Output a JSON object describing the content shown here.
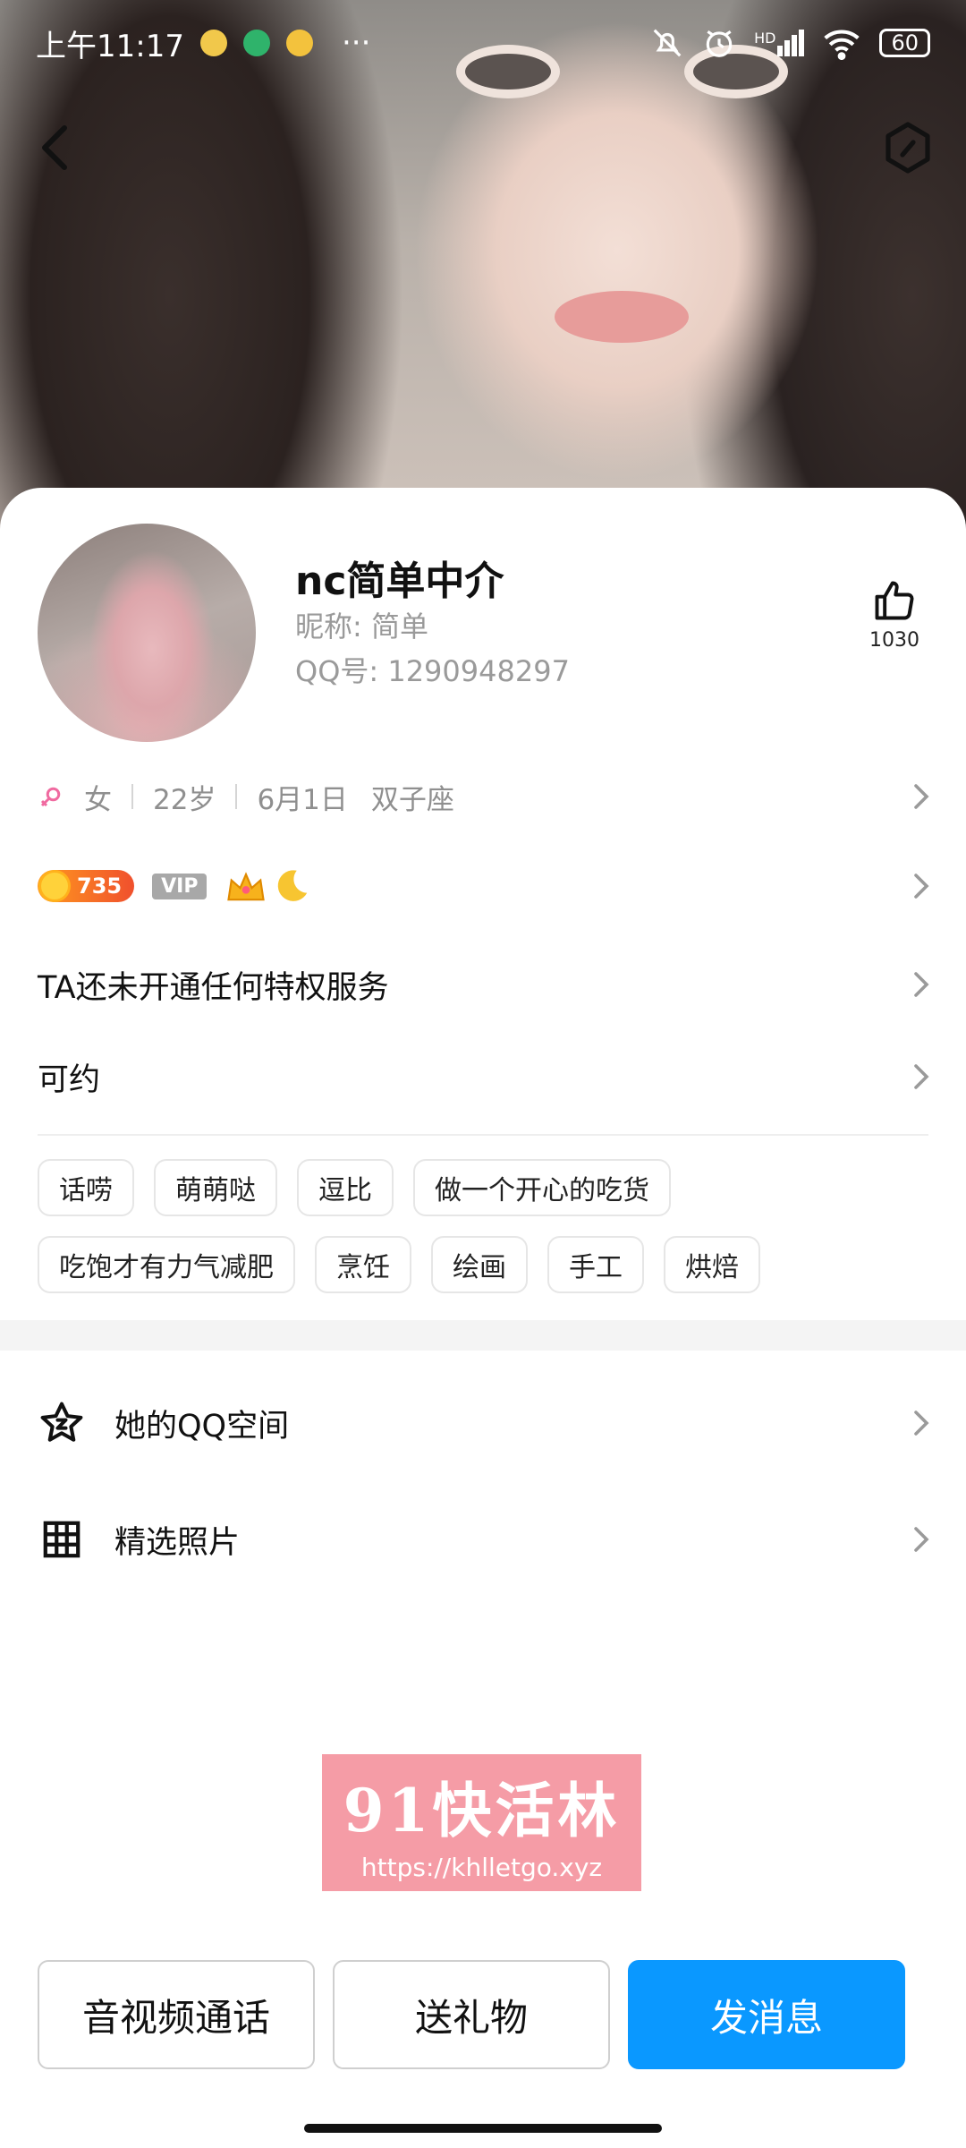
{
  "status_bar": {
    "time": "上午11:17",
    "more": "···",
    "network": "HD",
    "battery": "60",
    "icons": [
      "bell-off-icon",
      "alarm-icon",
      "signal-icon",
      "wifi-icon",
      "battery-icon"
    ]
  },
  "header": {
    "back_icon": "chevron-left-icon",
    "action_icon": "hexagon-icon"
  },
  "profile": {
    "name": "nc简单中介",
    "nickname": "昵称: 简单",
    "qq": "QQ号: 1290948297",
    "likes": "1030",
    "gender_icon": "female-icon",
    "gender": "女",
    "age": "22岁",
    "birthday": "6月1日",
    "zodiac": "双子座"
  },
  "badges": {
    "level": "735",
    "vip": "VIP",
    "crown_icon": "crown-icon",
    "moon_icon": "moon-icon"
  },
  "privilege": {
    "label": "TA还未开通任何特权服务"
  },
  "availability": {
    "label": "可约"
  },
  "tags": [
    "话唠",
    "萌萌哒",
    "逗比",
    "做一个开心的吃货",
    "吃饱才有力气减肥",
    "烹饪",
    "绘画",
    "手工",
    "烘焙"
  ],
  "menu": {
    "qzone": {
      "label": "她的QQ空间",
      "icon": "qzone-star-icon"
    },
    "photos": {
      "label": "精选照片",
      "icon": "grid-icon"
    }
  },
  "watermark": {
    "title": "91快活林",
    "url": "https://khlletgo.xyz"
  },
  "actions": {
    "call": "音视频通话",
    "gift": "送礼物",
    "message": "发消息"
  },
  "colors": {
    "primary": "#0a98ff",
    "level_badge": "#f0502d",
    "watermark": "#f59ca6",
    "muted_text": "#9a9a9a"
  }
}
